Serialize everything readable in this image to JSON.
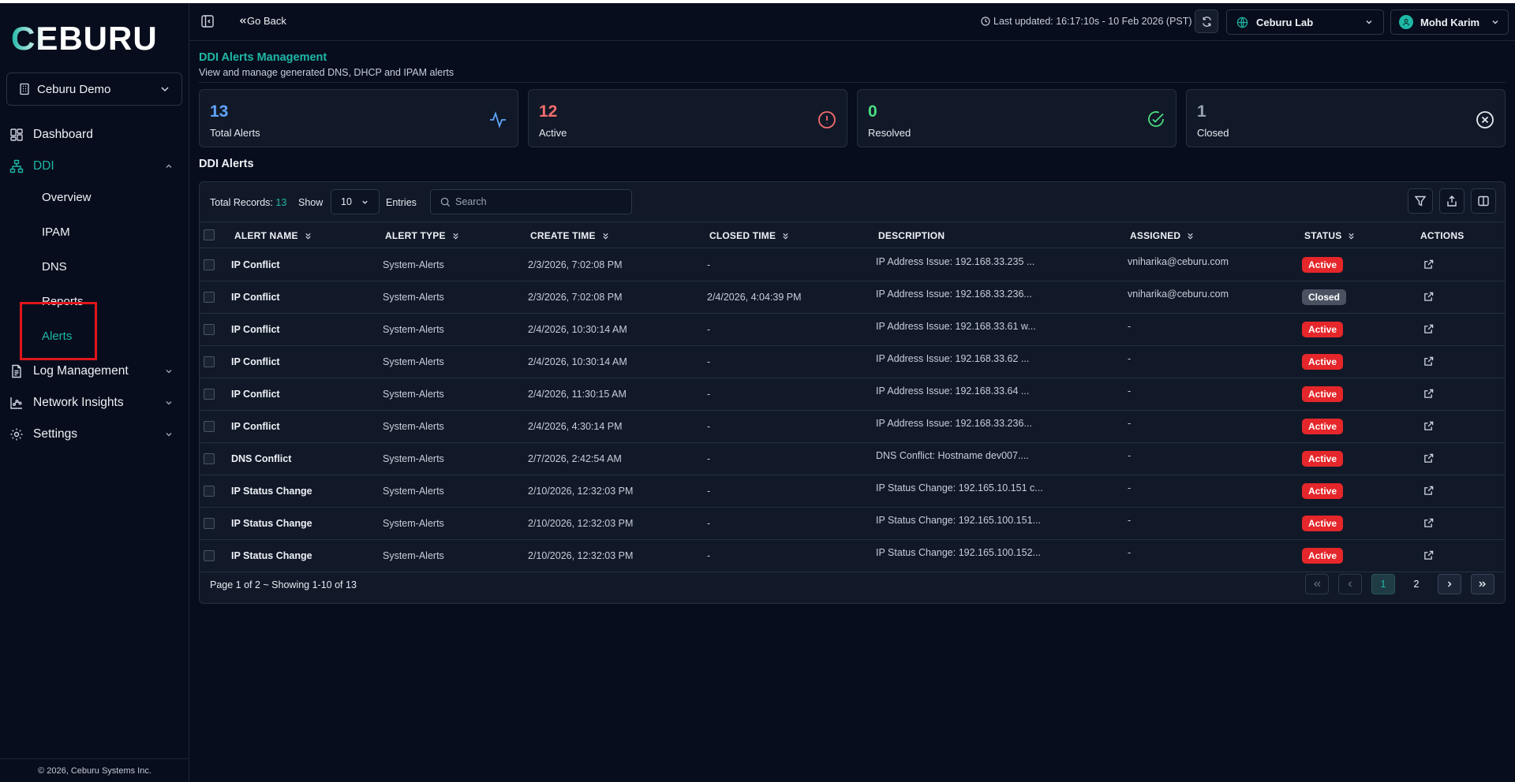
{
  "brand": {
    "logo_text": "CEBURU"
  },
  "sidebar": {
    "org": "Ceburu Demo",
    "nav": {
      "dashboard": "Dashboard",
      "ddi": "DDI",
      "ddi_sub": {
        "overview": "Overview",
        "ipam": "IPAM",
        "dns": "DNS",
        "reports": "Reports",
        "alerts": "Alerts"
      },
      "log_management": "Log Management",
      "network_insights": "Network Insights",
      "settings": "Settings"
    },
    "footer": "© 2026, Ceburu Systems Inc."
  },
  "topbar": {
    "go_back": "Go Back",
    "last_updated": "Last updated: 16:17:10s - 10 Feb 2026 (PST)",
    "site": "Ceburu Lab",
    "user": "Mohd Karim"
  },
  "page": {
    "title": "DDI Alerts Management",
    "subtitle": "View and manage generated DNS, DHCP and IPAM alerts",
    "section_title": "DDI Alerts"
  },
  "stats": [
    {
      "value": "13",
      "label": "Total Alerts",
      "color": "#60a5fa",
      "icon": "activity-icon"
    },
    {
      "value": "12",
      "label": "Active",
      "color": "#f26d6d",
      "icon": "alert-circle-icon"
    },
    {
      "value": "0",
      "label": "Resolved",
      "color": "#4ade80",
      "icon": "check-circle-icon"
    },
    {
      "value": "1",
      "label": "Closed",
      "color": "#9aa3b5",
      "icon": "x-circle-icon"
    }
  ],
  "table": {
    "total_label": "Total Records:",
    "total_count": "13",
    "show_label": "Show",
    "show_value": "10",
    "entries_label": "Entries",
    "search_placeholder": "Search",
    "columns": [
      "ALERT NAME",
      "ALERT TYPE",
      "CREATE TIME",
      "CLOSED TIME",
      "DESCRIPTION",
      "ASSIGNED",
      "STATUS",
      "ACTIONS"
    ],
    "rows": [
      {
        "name": "IP Conflict",
        "type": "System-Alerts",
        "created": "2/3/2026, 7:02:08 PM",
        "closed": "-",
        "description": "IP Address Issue: 192.168.33.235 ...",
        "assigned": "vniharika@ceburu.com",
        "status": "Active"
      },
      {
        "name": "IP Conflict",
        "type": "System-Alerts",
        "created": "2/3/2026, 7:02:08 PM",
        "closed": "2/4/2026, 4:04:39 PM",
        "description": "IP Address Issue: 192.168.33.236...",
        "assigned": "vniharika@ceburu.com",
        "status": "Closed"
      },
      {
        "name": "IP Conflict",
        "type": "System-Alerts",
        "created": "2/4/2026, 10:30:14 AM",
        "closed": "-",
        "description": "IP Address Issue: 192.168.33.61 w...",
        "assigned": "-",
        "status": "Active"
      },
      {
        "name": "IP Conflict",
        "type": "System-Alerts",
        "created": "2/4/2026, 10:30:14 AM",
        "closed": "-",
        "description": "IP Address Issue: 192.168.33.62 ...",
        "assigned": "-",
        "status": "Active"
      },
      {
        "name": "IP Conflict",
        "type": "System-Alerts",
        "created": "2/4/2026, 11:30:15 AM",
        "closed": "-",
        "description": "IP Address Issue: 192.168.33.64 ...",
        "assigned": "-",
        "status": "Active"
      },
      {
        "name": "IP Conflict",
        "type": "System-Alerts",
        "created": "2/4/2026, 4:30:14 PM",
        "closed": "-",
        "description": "IP Address Issue: 192.168.33.236...",
        "assigned": "-",
        "status": "Active"
      },
      {
        "name": "DNS Conflict",
        "type": "System-Alerts",
        "created": "2/7/2026, 2:42:54 AM",
        "closed": "-",
        "description": "DNS Conflict: Hostname dev007....",
        "assigned": "-",
        "status": "Active"
      },
      {
        "name": "IP Status Change",
        "type": "System-Alerts",
        "created": "2/10/2026, 12:32:03 PM",
        "closed": "-",
        "description": "IP Status Change: 192.165.10.151 c...",
        "assigned": "-",
        "status": "Active"
      },
      {
        "name": "IP Status Change",
        "type": "System-Alerts",
        "created": "2/10/2026, 12:32:03 PM",
        "closed": "-",
        "description": "IP Status Change: 192.165.100.151...",
        "assigned": "-",
        "status": "Active"
      },
      {
        "name": "IP Status Change",
        "type": "System-Alerts",
        "created": "2/10/2026, 12:32:03 PM",
        "closed": "-",
        "description": "IP Status Change: 192.165.100.152...",
        "assigned": "-",
        "status": "Active"
      }
    ],
    "page_info": "Page 1 of 2 ~ Showing 1-10 of 13",
    "pages": [
      "1",
      "2"
    ]
  },
  "colors": {
    "accent": "#1fb7a6",
    "active_badge": "#e5262a",
    "closed_badge": "#4a5261",
    "bg": "#070d1c",
    "panel": "#111928"
  }
}
